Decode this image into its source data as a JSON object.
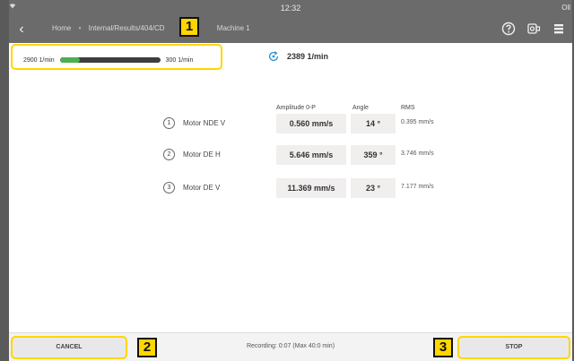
{
  "status_bar": {
    "time": "12:32",
    "battery_label": "Oll"
  },
  "nav": {
    "back_icon": "chevron-left-icon",
    "breadcrumb": {
      "home": "Home",
      "path": "Internal/Results/404/CD",
      "machine": "Machine 1"
    },
    "icons": [
      "help-icon",
      "device-icon",
      "menu-icon"
    ]
  },
  "callouts": {
    "one": "1",
    "two": "2",
    "three": "3"
  },
  "speed": {
    "max_label": "2900 1/min",
    "min_label": "300 1/min",
    "fill_fraction": 0.2,
    "current_rpm": "2389 1/min"
  },
  "table": {
    "headers": {
      "amplitude": "Amplitude 0-P",
      "angle": "Angle",
      "rms": "RMS"
    },
    "rows": [
      {
        "num": "1",
        "label": "Motor NDE V",
        "amplitude": "0.560 mm/s",
        "angle": "14 °",
        "rms": "0.395 mm/s"
      },
      {
        "num": "2",
        "label": "Motor DE H",
        "amplitude": "5.646 mm/s",
        "angle": "359 °",
        "rms": "3.746 mm/s"
      },
      {
        "num": "3",
        "label": "Motor DE V",
        "amplitude": "11.369 mm/s",
        "angle": "23 °",
        "rms": "7.177 mm/s"
      }
    ]
  },
  "footer": {
    "cancel_label": "CANCEL",
    "recording_text": "Recording: 0:07 (Max 40:0 min)",
    "stop_label": "STOP"
  },
  "colors": {
    "callout": "#ffd600",
    "speed_fill": "#4caf50",
    "rpm_icon": "#2a8fd0"
  }
}
